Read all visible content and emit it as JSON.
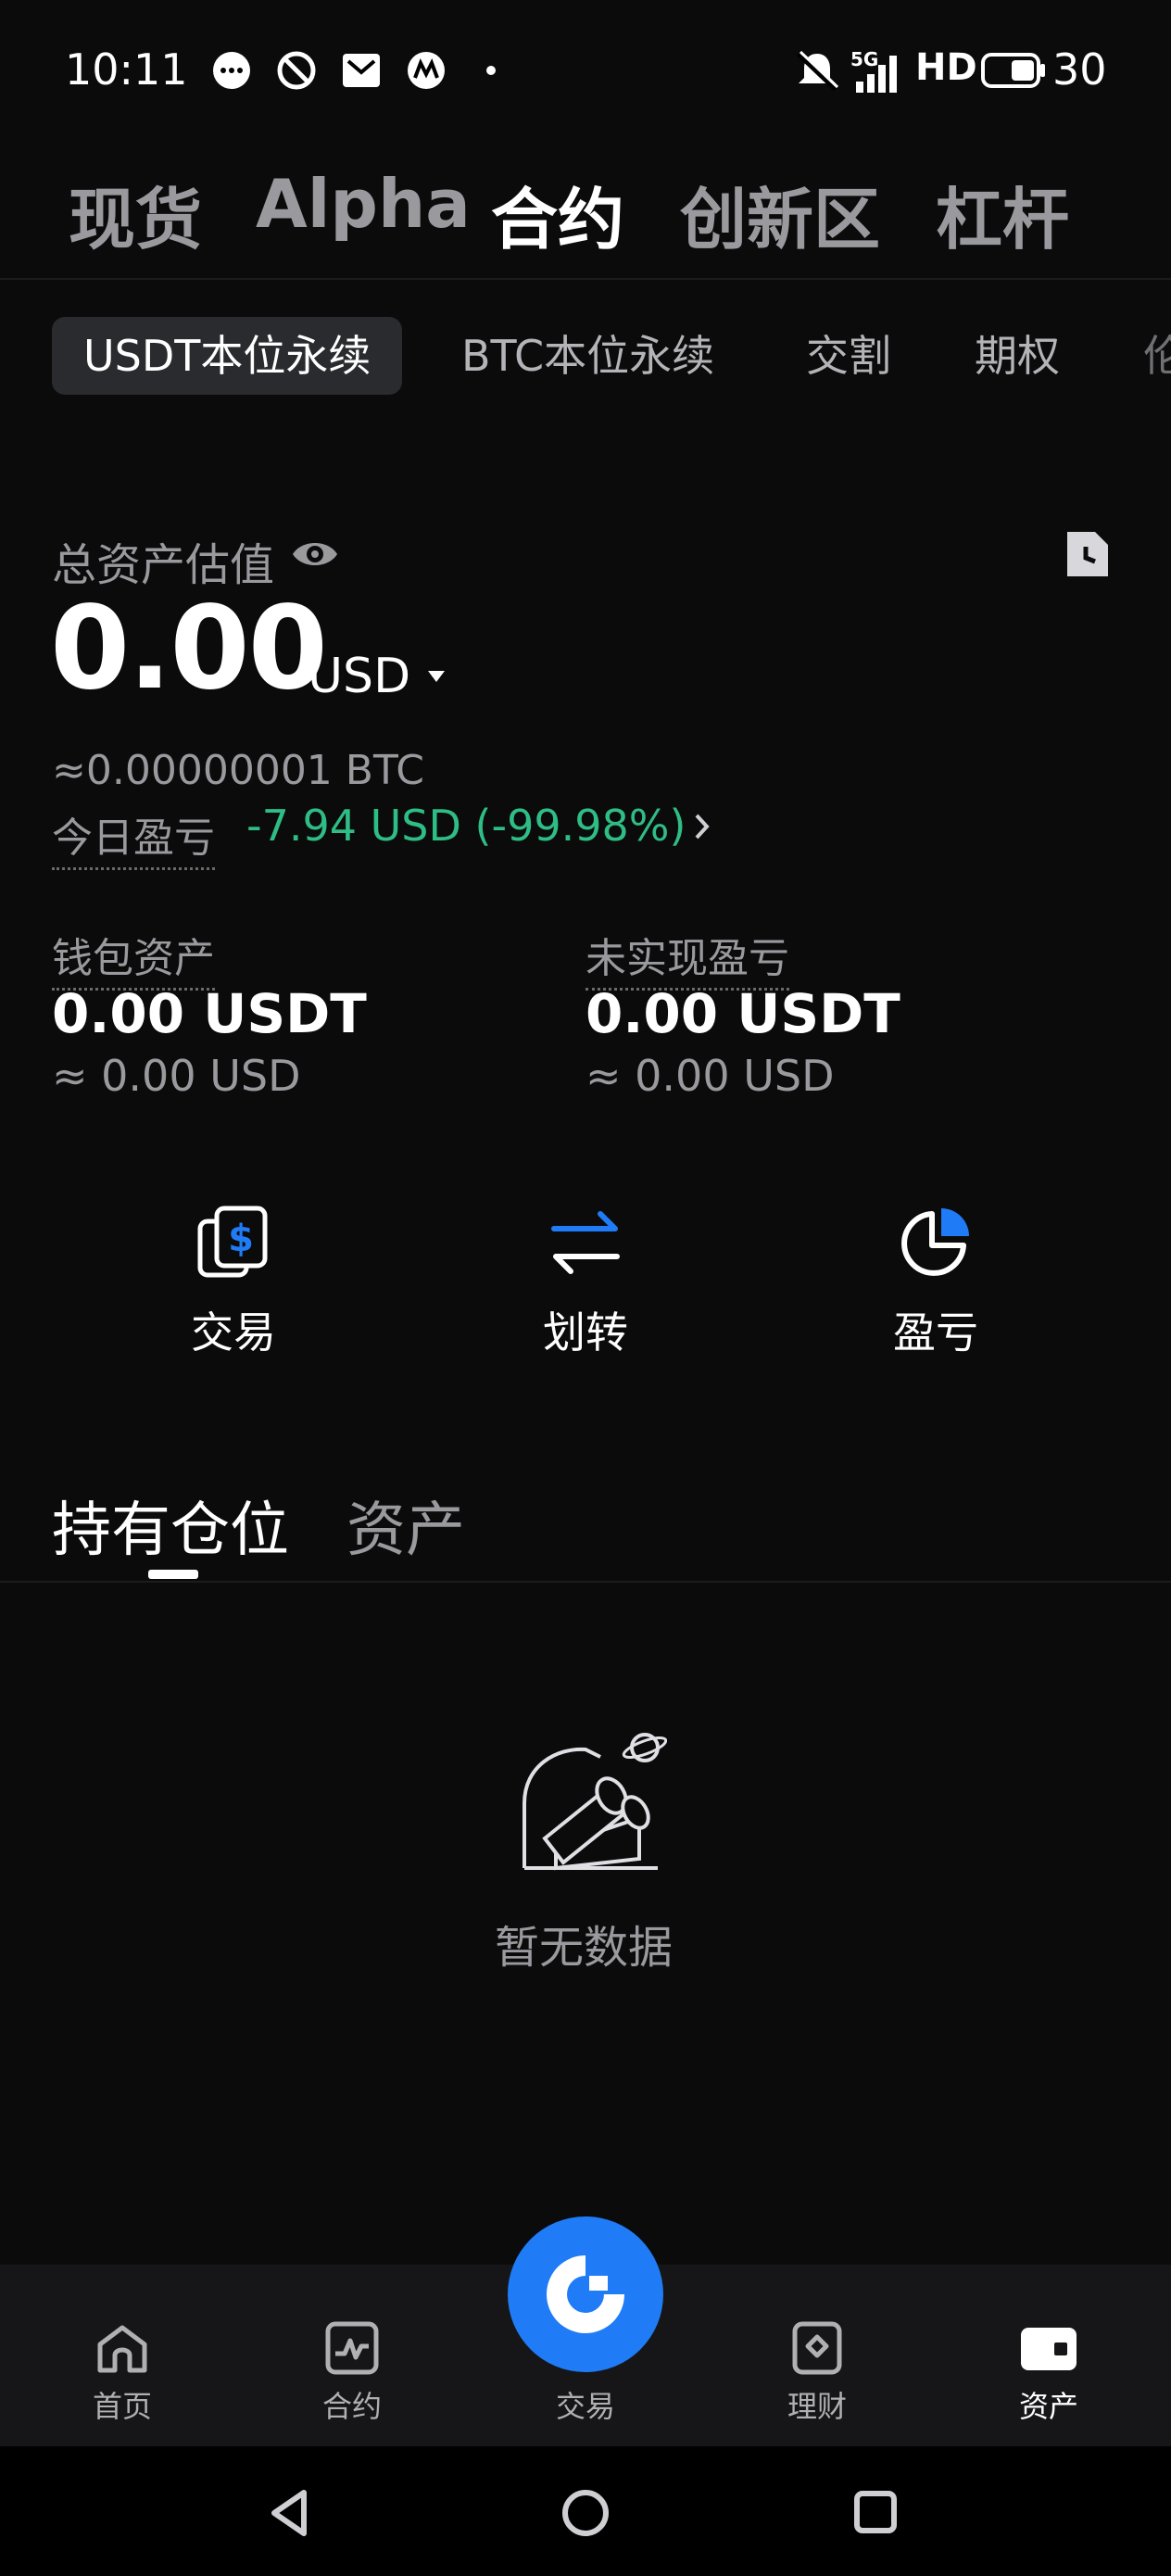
{
  "status_bar": {
    "time": "10:11",
    "network": "5G",
    "hd": "HD",
    "battery": "30"
  },
  "top_nav": {
    "items": [
      "现货",
      "Alpha",
      "合约",
      "创新区",
      "杠杆"
    ],
    "active": "合约"
  },
  "sub_tabs": {
    "items": [
      "USDT本位永续",
      "BTC本位永续",
      "交割",
      "期权",
      "伦"
    ],
    "active": "USDT本位永续"
  },
  "summary": {
    "label": "总资产估值",
    "amount": "0.00",
    "currency": "USD",
    "btc_equiv": "≈0.00000001 BTC",
    "pnl_label": "今日盈亏",
    "pnl_value": "-7.94 USD (-99.98%)",
    "pnl_color": "#2ebd85"
  },
  "balances": {
    "wallet": {
      "label": "钱包资产",
      "value": "0.00 USDT",
      "usd": "≈ 0.00 USD"
    },
    "unrealized": {
      "label": "未实现盈亏",
      "value": "0.00 USDT",
      "usd": "≈ 0.00 USD"
    }
  },
  "actions": {
    "trade": "交易",
    "transfer": "划转",
    "pnl": "盈亏"
  },
  "section_tabs": {
    "positions": "持有仓位",
    "assets": "资产"
  },
  "empty_state": {
    "text": "暂无数据"
  },
  "bottom_nav": {
    "home": "首页",
    "futures": "合约",
    "trade": "交易",
    "earn": "理财",
    "assets": "资产",
    "active": "资产",
    "accent": "#1f7cf6"
  }
}
